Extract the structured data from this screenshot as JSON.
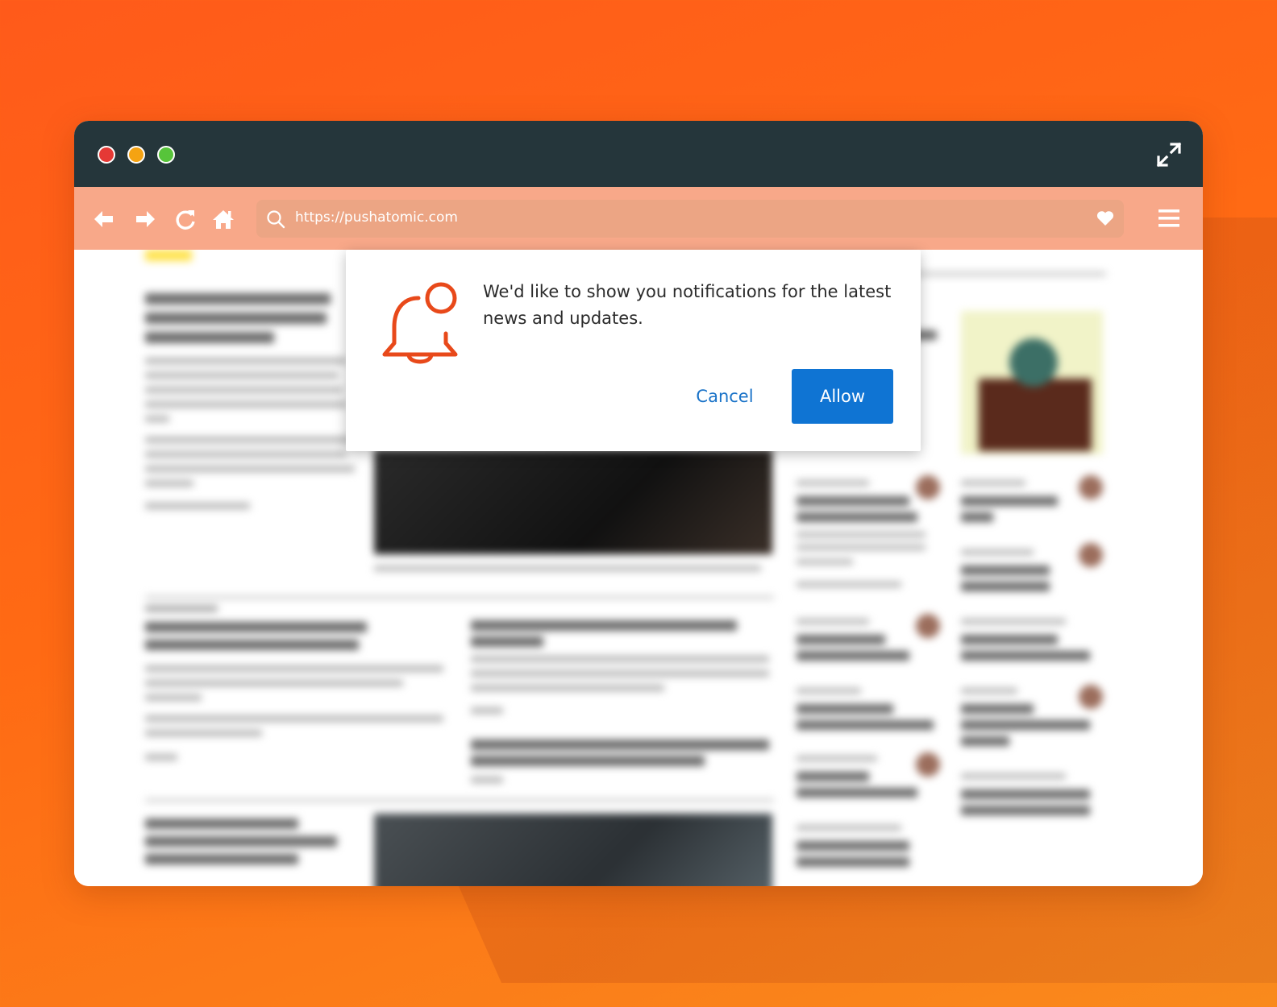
{
  "browser": {
    "url": "https://pushatomic.com",
    "traffic_lights": [
      "close",
      "minimize",
      "zoom"
    ],
    "icons": [
      "back-arrow-icon",
      "forward-arrow-icon",
      "reload-icon",
      "home-icon",
      "search-icon",
      "heart-icon",
      "hamburger-menu-icon",
      "fullscreen-expand-icon"
    ]
  },
  "dialog": {
    "message": "We'd like to show you notifications for the latest news and updates.",
    "cancel_label": "Cancel",
    "allow_label": "Allow",
    "icon": "bell-icon"
  },
  "colors": {
    "background": "#ff6a14",
    "titlebar": "#25363b",
    "toolbar": "#f8a889",
    "accent_bell": "#e8491a",
    "allow_button": "#0f74d3"
  }
}
